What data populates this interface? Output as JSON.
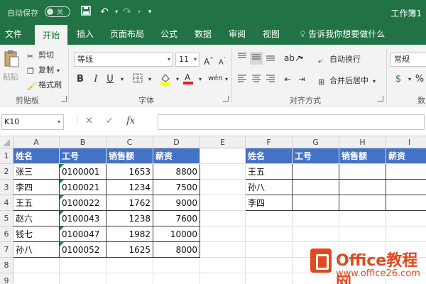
{
  "titlebar": {
    "autosave_label": "自动保存",
    "autosave_state": "关",
    "title": "工作簿1"
  },
  "tabs": [
    "文件",
    "开始",
    "插入",
    "页面布局",
    "公式",
    "数据",
    "审阅",
    "视图"
  ],
  "tell_me": "告诉我你想要做什么",
  "ribbon": {
    "clipboard": {
      "paste": "粘贴",
      "cut": "剪切",
      "copy": "复制",
      "format_painter": "格式刷",
      "label": "剪贴板"
    },
    "font": {
      "name": "等线",
      "size": "11",
      "label": "字体"
    },
    "alignment": {
      "wrap": "自动换行",
      "merge": "合并后居中",
      "label": "对齐方式"
    },
    "number": {
      "format": "常规",
      "label": "数"
    }
  },
  "formula_bar": {
    "name_box": "K10",
    "formula": ""
  },
  "columns": [
    "A",
    "B",
    "C",
    "D",
    "E",
    "F",
    "G",
    "H",
    "I"
  ],
  "rows": [
    "1",
    "2",
    "3",
    "4",
    "5",
    "6",
    "7",
    "8",
    "9"
  ],
  "table1": {
    "headers": [
      "姓名",
      "工号",
      "销售额",
      "薪资"
    ],
    "rows": [
      [
        "张三",
        "0100001",
        "1653",
        "8800"
      ],
      [
        "李四",
        "0100021",
        "1234",
        "7500"
      ],
      [
        "王五",
        "0100022",
        "1762",
        "9000"
      ],
      [
        "赵六",
        "0100043",
        "1238",
        "7600"
      ],
      [
        "钱七",
        "0100047",
        "1982",
        "10000"
      ],
      [
        "孙八",
        "0100052",
        "1625",
        "8000"
      ]
    ]
  },
  "table2": {
    "headers": [
      "姓名",
      "工号",
      "销售额",
      "薪资"
    ],
    "rows": [
      [
        "王五",
        "",
        "",
        ""
      ],
      [
        "孙八",
        "",
        "",
        ""
      ],
      [
        "李四",
        "",
        "",
        ""
      ]
    ]
  },
  "watermark": {
    "main": "Office教程网",
    "sub": "www.office26.com"
  },
  "colors": {
    "excel_green": "#217346",
    "header_blue": "#4472c4",
    "flag_green": "#1f8a3a",
    "watermark_orange": "#e04a1f"
  }
}
